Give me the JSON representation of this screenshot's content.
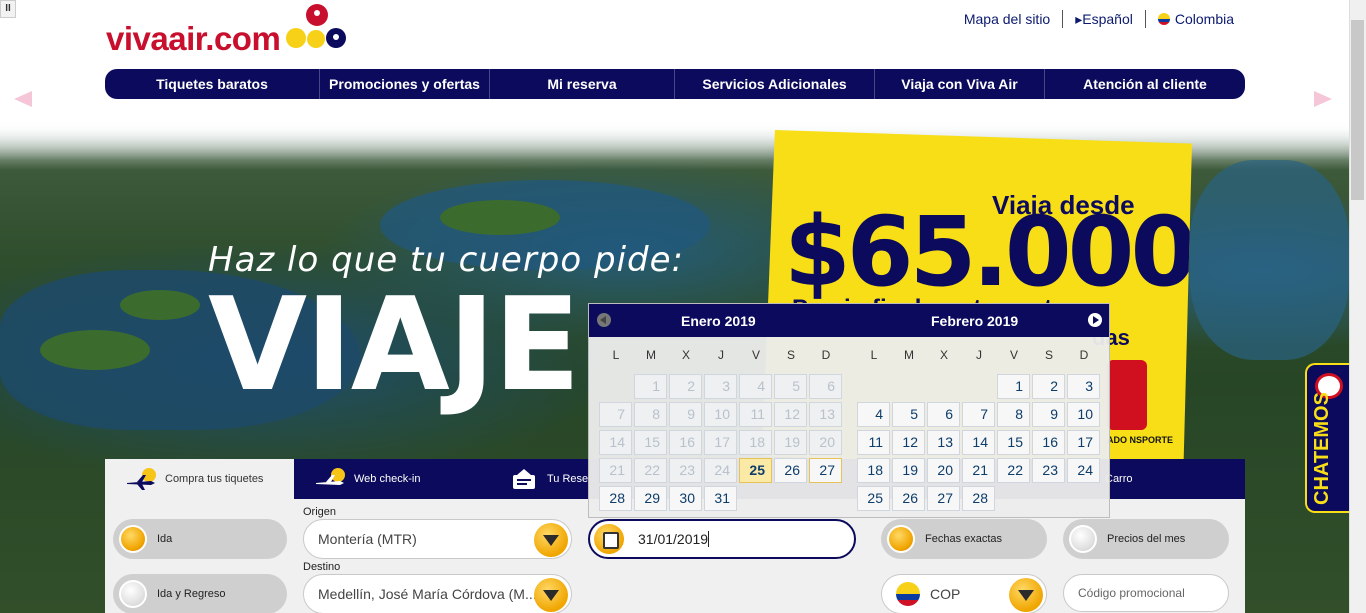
{
  "header": {
    "pause_label": "II",
    "logo": {
      "viva": "viva",
      "air": "air",
      "com": ".com"
    },
    "links": [
      {
        "label": "Mapa del sitio"
      },
      {
        "label": "▸Español"
      },
      {
        "label": "Colombia"
      }
    ]
  },
  "nav": {
    "items": [
      {
        "label": "Tiquetes baratos"
      },
      {
        "label": "Promociones y ofertas"
      },
      {
        "label": "Mi reserva"
      },
      {
        "label": "Servicios Adicionales"
      },
      {
        "label": "Viaja con Viva Air"
      },
      {
        "label": "Atención al cliente"
      }
    ]
  },
  "hero": {
    "tagline": "Haz lo que tu cuerpo pide:",
    "headline": "VIAJE",
    "promo_from": "Viaja desde",
    "promo_price": "$65.000*",
    "promo_sub": "Precio final por trayecto",
    "promo_sub2": "das",
    "promo_small": "ADO NSPORTE"
  },
  "chat": {
    "label": "CHATEMOS"
  },
  "booking": {
    "tabs": [
      {
        "label": "Compra tus tiquetes"
      },
      {
        "label": "Web check-in"
      },
      {
        "label": "Tu Rese"
      },
      {
        "label": "Carro"
      }
    ],
    "trip_type": {
      "one_way": "Ida",
      "round_trip": "Ida y Regreso"
    },
    "origin": {
      "label": "Origen",
      "value": "Montería (MTR)"
    },
    "destination": {
      "label": "Destino",
      "value": "Medellín, José María Córdova (M..."
    },
    "date_value": "31/01/2019",
    "date_mode": {
      "exact": "Fechas exactas",
      "month": "Precios del mes"
    },
    "currency": "COP",
    "promo_code_placeholder": "Código promocional"
  },
  "calendar": {
    "left_month": "Enero 2019",
    "right_month": "Febrero 2019",
    "weekdays": [
      "L",
      "M",
      "X",
      "J",
      "V",
      "S",
      "D"
    ],
    "january": [
      [
        null,
        "1",
        "2",
        "3",
        "4",
        "5",
        "6"
      ],
      [
        "7",
        "8",
        "9",
        "10",
        "11",
        "12",
        "13"
      ],
      [
        "14",
        "15",
        "16",
        "17",
        "18",
        "19",
        "20"
      ],
      [
        "21",
        "22",
        "23",
        "24",
        "25",
        "26",
        "27"
      ],
      [
        "28",
        "29",
        "30",
        "31",
        null,
        null,
        null
      ]
    ],
    "february": [
      [
        null,
        null,
        null,
        null,
        "1",
        "2",
        "3"
      ],
      [
        "4",
        "5",
        "6",
        "7",
        "8",
        "9",
        "10"
      ],
      [
        "11",
        "12",
        "13",
        "14",
        "15",
        "16",
        "17"
      ],
      [
        "18",
        "19",
        "20",
        "21",
        "22",
        "23",
        "24"
      ],
      [
        "25",
        "26",
        "27",
        "28",
        null,
        null,
        null
      ]
    ],
    "past_until": 24,
    "highlighted_day": "25",
    "colors": {
      "navy": "#0b0a5c",
      "yellow": "#f7de16",
      "orange": "#f0a500"
    }
  }
}
